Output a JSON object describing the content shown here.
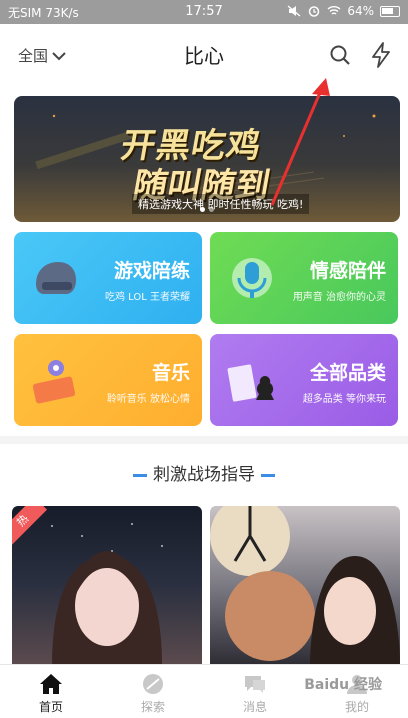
{
  "status_bar": {
    "carrier": "无SIM 73K/s",
    "time": "17:57",
    "battery": "64%"
  },
  "header": {
    "region": "全国",
    "title": "比心"
  },
  "banner": {
    "line1": "开黑吃鸡",
    "line2": "随叫随到",
    "subtitle": "精选游戏大神 即时任性畅玩 吃鸡!"
  },
  "categories": [
    {
      "title": "游戏陪练",
      "subtitle": "吃鸡 LOL 王者荣耀",
      "color": "#3ec3f4"
    },
    {
      "title": "情感陪伴",
      "subtitle": "用声音 治愈你的心灵",
      "color": "#5bd45c"
    },
    {
      "title": "音乐",
      "subtitle": "聆听音乐 放松心情",
      "color": "#ffb63a"
    },
    {
      "title": "全部品类",
      "subtitle": "超多品类 等你来玩",
      "color": "#a86de8"
    }
  ],
  "section": {
    "title": "刺激战场指导"
  },
  "feed": {
    "hot_tag": "热"
  },
  "tabbar": {
    "items": [
      {
        "label": "首页",
        "icon": "home-icon",
        "active": true
      },
      {
        "label": "探索",
        "icon": "explore-icon",
        "active": false
      },
      {
        "label": "消息",
        "icon": "message-icon",
        "active": false
      },
      {
        "label": "我的",
        "icon": "profile-icon",
        "active": false
      }
    ]
  },
  "watermark": "Baidu 经验"
}
